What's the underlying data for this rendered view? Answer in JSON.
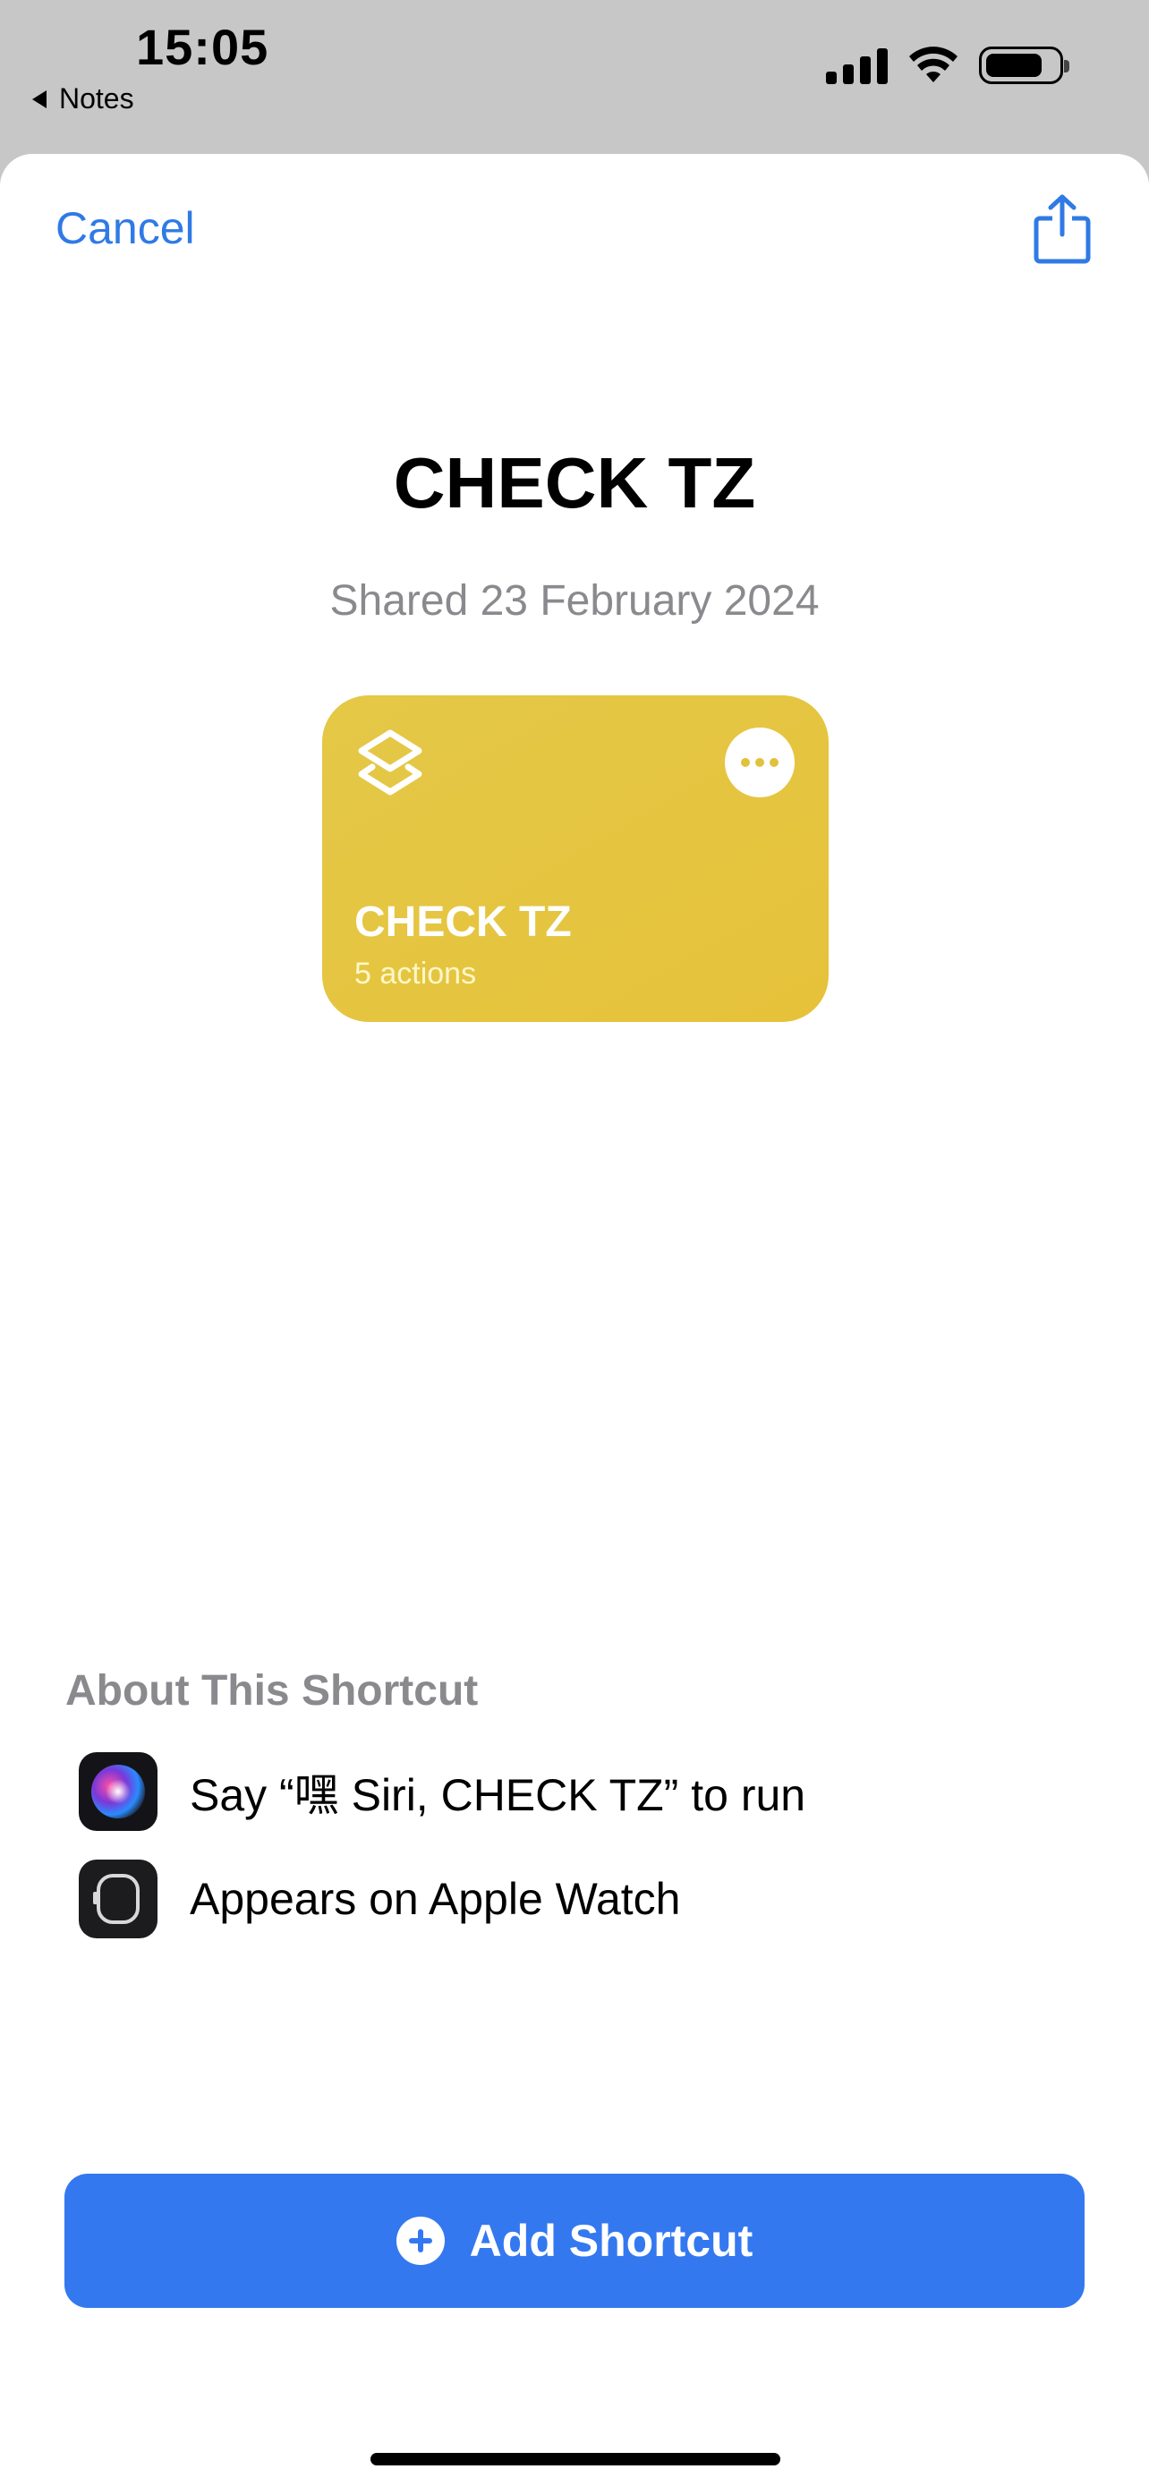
{
  "status_bar": {
    "time": "15:05",
    "back_app": "Notes",
    "icons": [
      "signal-icon",
      "wifi-icon",
      "battery-icon"
    ]
  },
  "header": {
    "cancel_label": "Cancel",
    "share_icon": "share-icon"
  },
  "shortcut": {
    "title": "CHECK TZ",
    "shared_date": "Shared 23 February 2024",
    "card": {
      "name": "CHECK TZ",
      "actions": "5 actions",
      "color": "#e5c53f",
      "icon": "layers-icon",
      "more_icon": "ellipsis-icon"
    }
  },
  "about": {
    "heading": "About This Shortcut",
    "items": [
      {
        "icon": "siri-icon",
        "text": "Say “嘿 Siri, CHECK TZ” to run"
      },
      {
        "icon": "apple-watch-icon",
        "text": "Appears on Apple Watch"
      }
    ]
  },
  "add_button": {
    "label": "Add Shortcut",
    "icon": "plus-circle-icon",
    "color": "#3478f0"
  },
  "colors": {
    "accent": "#2f7ae5",
    "secondary_text": "#8a8a8e"
  }
}
